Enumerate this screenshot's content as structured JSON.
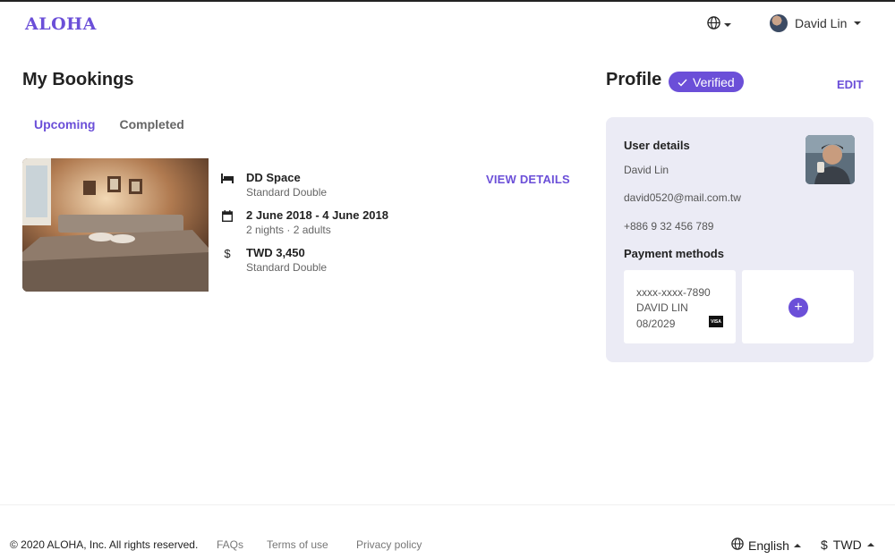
{
  "header": {
    "logo": "ALOHA",
    "user_name": "David Lin"
  },
  "bookings": {
    "title": "My Bookings",
    "tabs": [
      {
        "label": "Upcoming",
        "active": true
      },
      {
        "label": "Completed",
        "active": false
      }
    ],
    "item": {
      "place": "DD Space",
      "room_type": "Standard Double",
      "dates": "2 June 2018 - 4 June 2018",
      "stay_details": "2 nights · 2 adults",
      "price": "TWD 3,450",
      "price_detail": "Standard Double",
      "view_details": "VIEW DETAILS"
    }
  },
  "profile": {
    "title": "Profile",
    "verified": "Verified",
    "edit": "EDIT",
    "user_details_heading": "User details",
    "name": "David Lin",
    "email": "david0520@mail.com.tw",
    "phone": "+886 9 32 456 789",
    "payment_heading": "Payment methods",
    "card": {
      "number": "xxxx-xxxx-7890",
      "holder": "DAVID LIN",
      "expiry": "08/2029",
      "brand": "VISA"
    },
    "add_symbol": "+"
  },
  "footer": {
    "copyright": "© 2020 ALOHA, Inc. All rights reserved.",
    "links": [
      "FAQs",
      "Terms of use",
      "Privacy policy"
    ],
    "language": "English",
    "currency": "TWD",
    "currency_symbol": "$"
  },
  "colors": {
    "accent": "#6b4fd8",
    "card_bg": "#ebebf5"
  },
  "icons": {
    "bed": "bed-icon",
    "calendar": "calendar-icon",
    "dollar": "dollar-icon",
    "globe": "globe-icon"
  }
}
